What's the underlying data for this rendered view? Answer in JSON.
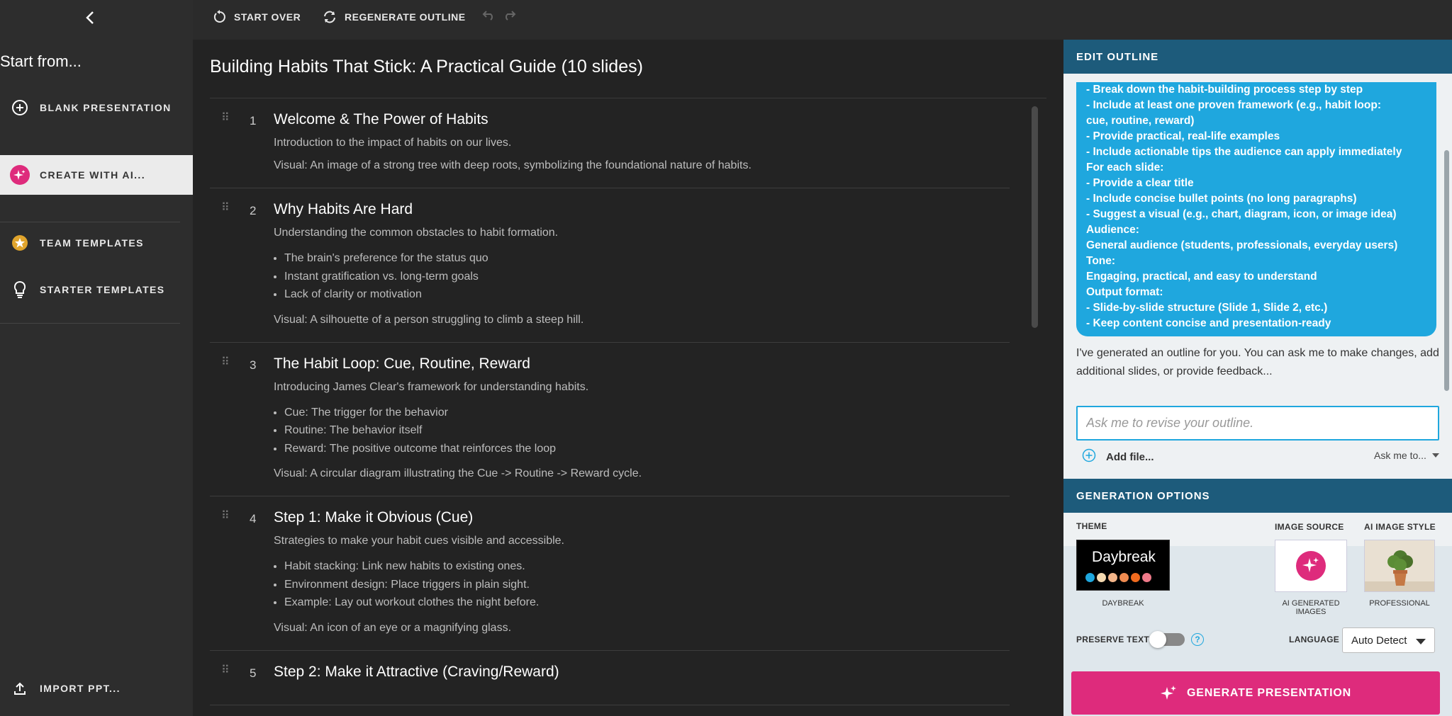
{
  "sidebar": {
    "title": "Start from...",
    "items": [
      {
        "label": "BLANK PRESENTATION",
        "icon": "plus-circle-icon"
      },
      {
        "label": "CREATE WITH AI...",
        "icon": "sparkle-icon"
      },
      {
        "label": "TEAM TEMPLATES",
        "icon": "star-badge-icon"
      },
      {
        "label": "STARTER TEMPLATES",
        "icon": "lightbulb-icon"
      }
    ],
    "import_label": "IMPORT PPT..."
  },
  "toolbar": {
    "start_over": "START OVER",
    "regenerate": "REGENERATE OUTLINE"
  },
  "outline": {
    "title": "Building Habits That Stick: A Practical Guide (10 slides)",
    "slides": [
      {
        "num": "1",
        "title": "Welcome & The Power of Habits",
        "subtitle": "Introduction to the impact of habits on our lives.",
        "bullets": [],
        "visual": "Visual: An image of a strong tree with deep roots, symbolizing the foundational nature of habits."
      },
      {
        "num": "2",
        "title": "Why Habits Are Hard",
        "subtitle": "Understanding the common obstacles to habit formation.",
        "bullets": [
          "The brain's preference for the status quo",
          "Instant gratification vs. long-term goals",
          "Lack of clarity or motivation"
        ],
        "visual": "Visual: A silhouette of a person struggling to climb a steep hill."
      },
      {
        "num": "3",
        "title": "The Habit Loop: Cue, Routine, Reward",
        "subtitle": "Introducing James Clear's framework for understanding habits.",
        "bullets": [
          "Cue: The trigger for the behavior",
          "Routine: The behavior itself",
          "Reward: The positive outcome that reinforces the loop"
        ],
        "visual": "Visual: A circular diagram illustrating the Cue -> Routine -> Reward cycle."
      },
      {
        "num": "4",
        "title": "Step 1: Make it Obvious (Cue)",
        "subtitle": "Strategies to make your habit cues visible and accessible.",
        "bullets": [
          "Habit stacking: Link new habits to existing ones.",
          "Environment design: Place triggers in plain sight.",
          "Example: Lay out workout clothes the night before."
        ],
        "visual": "Visual: An icon of an eye or a magnifying glass."
      },
      {
        "num": "5",
        "title": "Step 2: Make it Attractive (Craving/Reward)",
        "subtitle": "",
        "bullets": [],
        "visual": ""
      }
    ]
  },
  "edit_panel": {
    "header": "EDIT OUTLINE",
    "prompt_lines": [
      "- Break down the habit-building process step by step",
      "- Include at least one proven framework (e.g., habit loop:",
      "cue, routine, reward)",
      "- Provide practical, real-life examples",
      "- Include actionable tips the audience can apply immediately",
      "For each slide:",
      "- Provide a clear title",
      "- Include concise bullet points (no long paragraphs)",
      "- Suggest a visual (e.g., chart, diagram, icon, or image idea)",
      "Audience:",
      "General audience (students, professionals, everyday users)",
      "Tone:",
      "Engaging, practical, and easy to understand",
      "Output format:",
      "- Slide-by-slide structure (Slide 1, Slide 2, etc.)",
      "- Keep content concise and presentation-ready"
    ],
    "ai_message": "I've generated an outline for you. You can ask me to make changes, add additional slides, or provide feedback...",
    "input_placeholder": "Ask me to revise your outline.",
    "add_file": "Add file...",
    "ask_me": "Ask me to..."
  },
  "generation": {
    "header": "GENERATION OPTIONS",
    "theme_label": "THEME",
    "theme_name": "Daybreak",
    "theme_caption": "DAYBREAK",
    "theme_colors": [
      "#1fa7de",
      "#f4d9b0",
      "#f3b58a",
      "#ee8a50",
      "#f06a1e",
      "#ef7a8a"
    ],
    "image_source_label": "IMAGE SOURCE",
    "image_source_caption": "AI GENERATED IMAGES",
    "ai_style_label": "AI IMAGE STYLE",
    "ai_style_caption": "PROFESSIONAL",
    "preserve_text_label": "PRESERVE TEXT",
    "preserve_text_on": false,
    "language_label": "LANGUAGE",
    "language_value": "Auto Detect",
    "generate_button": "GENERATE PRESENTATION"
  },
  "colors": {
    "accent_pink": "#de2b7c",
    "accent_blue": "#1fa7de",
    "header_blue": "#1d5b7b"
  }
}
